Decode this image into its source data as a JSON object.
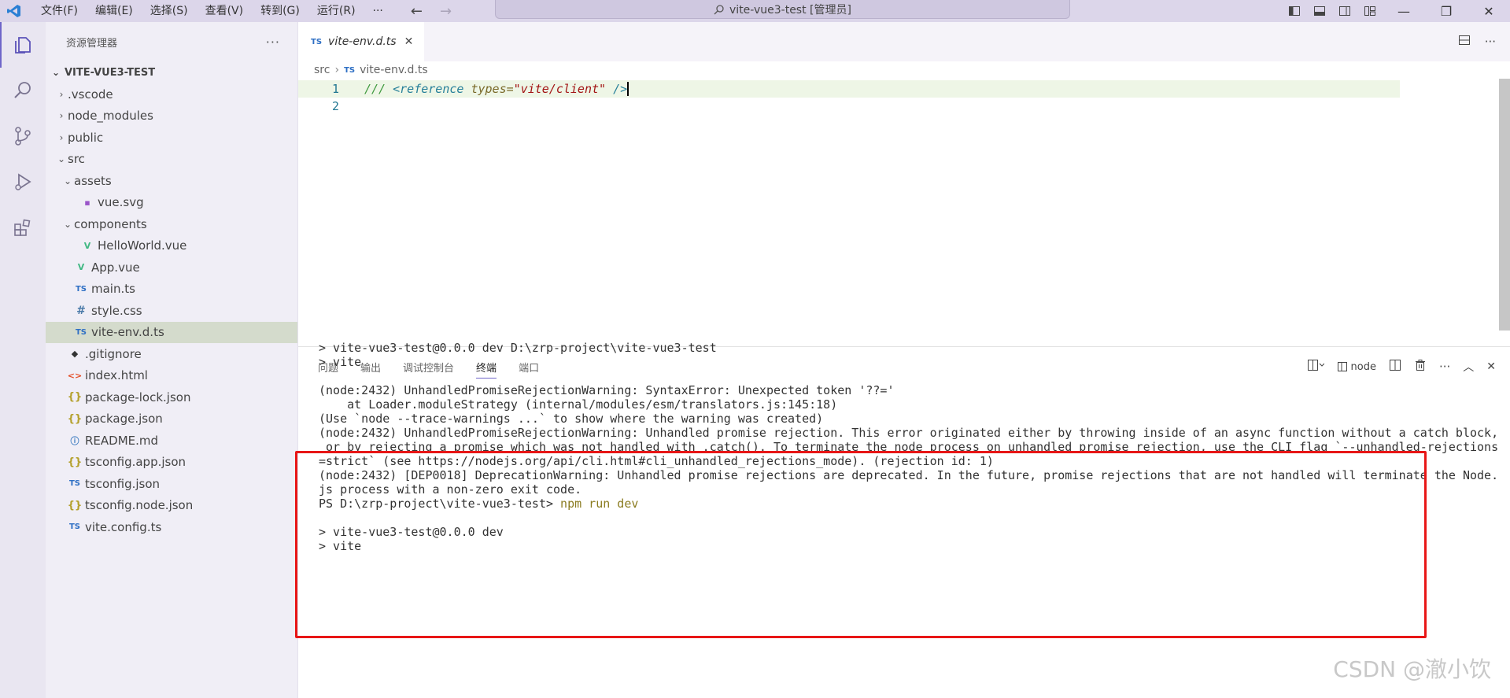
{
  "titlebar": {
    "menu": [
      "文件(F)",
      "编辑(E)",
      "选择(S)",
      "查看(V)",
      "转到(G)",
      "运行(R)",
      "···"
    ],
    "search_text": "vite-vue3-test [管理员]",
    "nav_back": "←",
    "nav_forward": "→",
    "win_min": "—",
    "win_restore": "❐",
    "win_close": "✕"
  },
  "sidebar": {
    "title": "资源管理器",
    "more": "···",
    "root": "VITE-VUE3-TEST",
    "items": [
      {
        "label": ".vscode",
        "twisty": "›",
        "icon": "",
        "level": 1
      },
      {
        "label": "node_modules",
        "twisty": "›",
        "icon": "",
        "level": 1
      },
      {
        "label": "public",
        "twisty": "›",
        "icon": "",
        "level": 1
      },
      {
        "label": "src",
        "twisty": "⌄",
        "icon": "",
        "level": 1
      },
      {
        "label": "assets",
        "twisty": "⌄",
        "icon": "",
        "level": 2
      },
      {
        "label": "vue.svg",
        "twisty": "",
        "icon": "svg",
        "level": 3
      },
      {
        "label": "components",
        "twisty": "⌄",
        "icon": "",
        "level": 2
      },
      {
        "label": "HelloWorld.vue",
        "twisty": "",
        "icon": "vue",
        "level": 3
      },
      {
        "label": "App.vue",
        "twisty": "",
        "icon": "vue",
        "level": 2
      },
      {
        "label": "main.ts",
        "twisty": "",
        "icon": "ts",
        "level": 2
      },
      {
        "label": "style.css",
        "twisty": "",
        "icon": "css",
        "level": 2
      },
      {
        "label": "vite-env.d.ts",
        "twisty": "",
        "icon": "ts",
        "level": 2,
        "selected": true
      },
      {
        "label": ".gitignore",
        "twisty": "",
        "icon": "git",
        "level": 1
      },
      {
        "label": "index.html",
        "twisty": "",
        "icon": "html",
        "level": 1
      },
      {
        "label": "package-lock.json",
        "twisty": "",
        "icon": "json",
        "level": 1
      },
      {
        "label": "package.json",
        "twisty": "",
        "icon": "json",
        "level": 1
      },
      {
        "label": "README.md",
        "twisty": "",
        "icon": "info",
        "level": 1
      },
      {
        "label": "tsconfig.app.json",
        "twisty": "",
        "icon": "json",
        "level": 1
      },
      {
        "label": "tsconfig.json",
        "twisty": "",
        "icon": "tsconfig",
        "level": 1
      },
      {
        "label": "tsconfig.node.json",
        "twisty": "",
        "icon": "json",
        "level": 1
      },
      {
        "label": "vite.config.ts",
        "twisty": "",
        "icon": "ts",
        "level": 1
      }
    ]
  },
  "icons": {
    "ts": "TS",
    "vue": "V",
    "css": "#",
    "json": "{}",
    "git": "◆",
    "html": "<>",
    "info": "ⓘ",
    "svg": "▪",
    "tsconfig": "TS"
  },
  "editor": {
    "tab_label": "vite-env.d.ts",
    "tab_icon": "TS",
    "tab_close": "✕",
    "breadcrumb_folder": "src",
    "breadcrumb_sep": "›",
    "breadcrumb_file": "vite-env.d.ts",
    "lines": [
      {
        "n": "1"
      },
      {
        "n": "2"
      }
    ],
    "code": {
      "comment": "/// ",
      "tag_open": "<reference ",
      "attr": "types=",
      "value": "\"vite/client\"",
      "tag_close": " />"
    }
  },
  "panel": {
    "tabs": [
      "问题",
      "输出",
      "调试控制台",
      "终端",
      "端口"
    ],
    "active_tab": "终端",
    "shell_label": "node",
    "terminal_lines": [
      "> vite-vue3-test@0.0.0 dev D:\\zrp-project\\vite-vue3-test",
      "> vite",
      "",
      "(node:2432) UnhandledPromiseRejectionWarning: SyntaxError: Unexpected token '??='",
      "    at Loader.moduleStrategy (internal/modules/esm/translators.js:145:18)",
      "(Use `node --trace-warnings ...` to show where the warning was created)",
      "(node:2432) UnhandledPromiseRejectionWarning: Unhandled promise rejection. This error originated either by throwing inside of an async function without a catch block,",
      " or by rejecting a promise which was not handled with .catch(). To terminate the node process on unhandled promise rejection, use the CLI flag `--unhandled-rejections",
      "=strict` (see https://nodejs.org/api/cli.html#cli_unhandled_rejections_mode). (rejection id: 1)",
      "(node:2432) [DEP0018] DeprecationWarning: Unhandled promise rejections are deprecated. In the future, promise rejections that are not handled will terminate the Node.",
      "js process with a non-zero exit code."
    ],
    "prompt": "PS D:\\zrp-project\\vite-vue3-test> ",
    "prompt_cmd": "npm run dev",
    "after_lines": [
      "> vite-vue3-test@0.0.0 dev",
      "> vite"
    ]
  },
  "watermark": "CSDN @澈小饮"
}
